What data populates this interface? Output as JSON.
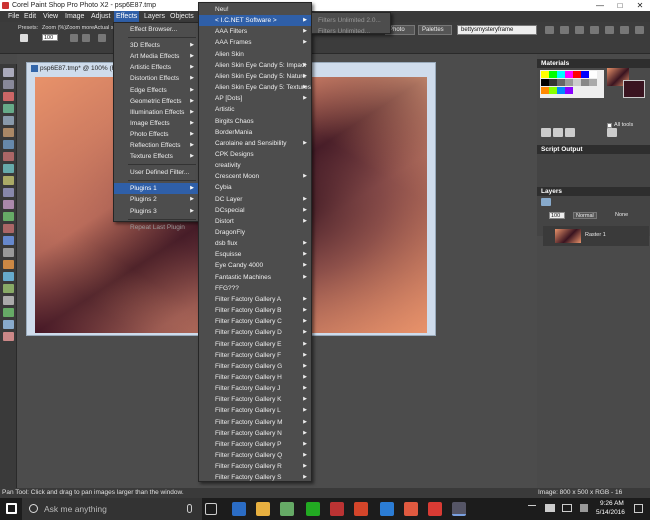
{
  "window": {
    "title": "Corel Paint Shop Pro Photo X2 - psp6E87.tmp",
    "minimize": "—",
    "maximize": "□",
    "close": "✕"
  },
  "menubar": {
    "items": [
      "File",
      "Edit",
      "View",
      "Image",
      "Adjust",
      "Effects",
      "Layers",
      "Objects",
      "Selections",
      "Window",
      "Help"
    ],
    "photo": "Photo",
    "palettes": "Palettes",
    "dropdown_value": "bettysmysteryframe"
  },
  "toolbar": {
    "presets_label": "Presets:",
    "zoom_pct_label": "Zoom (%):",
    "zoom_pct_value": "100",
    "zoom_more_label": "Zoom more:",
    "actual_size_label": "Actual size:"
  },
  "effects_menu": {
    "items": [
      "Effect Browser...",
      "3D Effects",
      "Art Media Effects",
      "Artistic Effects",
      "Distortion Effects",
      "Edge Effects",
      "Geometric Effects",
      "Illumination Effects",
      "Image Effects",
      "Photo Effects",
      "Reflection Effects",
      "Texture Effects",
      "User Defined Filter...",
      "Plugins 1",
      "Plugins 2",
      "Plugins 3",
      "Repeat Last Plugin"
    ]
  },
  "plugins_menu": {
    "items": [
      "Neu!",
      "< I.C.NET Software >",
      "AAA Filters",
      "AAA Frames",
      "Alien Skin",
      "Alien Skin Eye Candy 5: Impact",
      "Alien Skin Eye Candy 5: Nature",
      "Alien Skin Eye Candy 5: Textures",
      "AP [Dots]",
      "Artistic",
      "Birgits Chaos",
      "BorderMania",
      "Carolaine and Sensibility",
      "CPK Designs",
      "creativity",
      "Crescent Moon",
      "Cybia",
      "DC Layer",
      "DCspecial",
      "Distort",
      "DragonFly",
      "dsb flux",
      "Esquisse",
      "Eye Candy 4000",
      "Fantastic Machines",
      "FFG???",
      "Filter Factory Gallery A",
      "Filter Factory Gallery B",
      "Filter Factory Gallery C",
      "Filter Factory Gallery D",
      "Filter Factory Gallery E",
      "Filter Factory Gallery F",
      "Filter Factory Gallery G",
      "Filter Factory Gallery H",
      "Filter Factory Gallery J",
      "Filter Factory Gallery K",
      "Filter Factory Gallery L",
      "Filter Factory Gallery M",
      "Filter Factory Gallery N",
      "Filter Factory Gallery P",
      "Filter Factory Gallery Q",
      "Filter Factory Gallery R",
      "Filter Factory Gallery S"
    ]
  },
  "submenu": {
    "items": [
      "Filters Unlimited 2.0...",
      "Filters Unlimited..."
    ]
  },
  "image_window": {
    "title": "psp6E87.tmp* @ 100% (Raste"
  },
  "panels": {
    "materials_title": "Materials",
    "all_tools": "All tools",
    "script_output_title": "Script Output",
    "layers_title": "Layers",
    "opacity": "100",
    "blend_mode": "Normal",
    "none_label": "None",
    "layer_name": "Raster 1"
  },
  "status": {
    "left": "Pan Tool: Click and drag to pan images larger than the window.",
    "right": "Image: 800 x 500 x RGB - 16 bits/channel"
  },
  "taskbar": {
    "search_placeholder": "Ask me anything",
    "time": "9:26 AM",
    "date": "5/14/2016"
  },
  "colors": {
    "accent": "#2f5fa8",
    "menu_bg": "#4d4d4d",
    "peach": "#e8926a",
    "maroon": "#3a1420"
  }
}
